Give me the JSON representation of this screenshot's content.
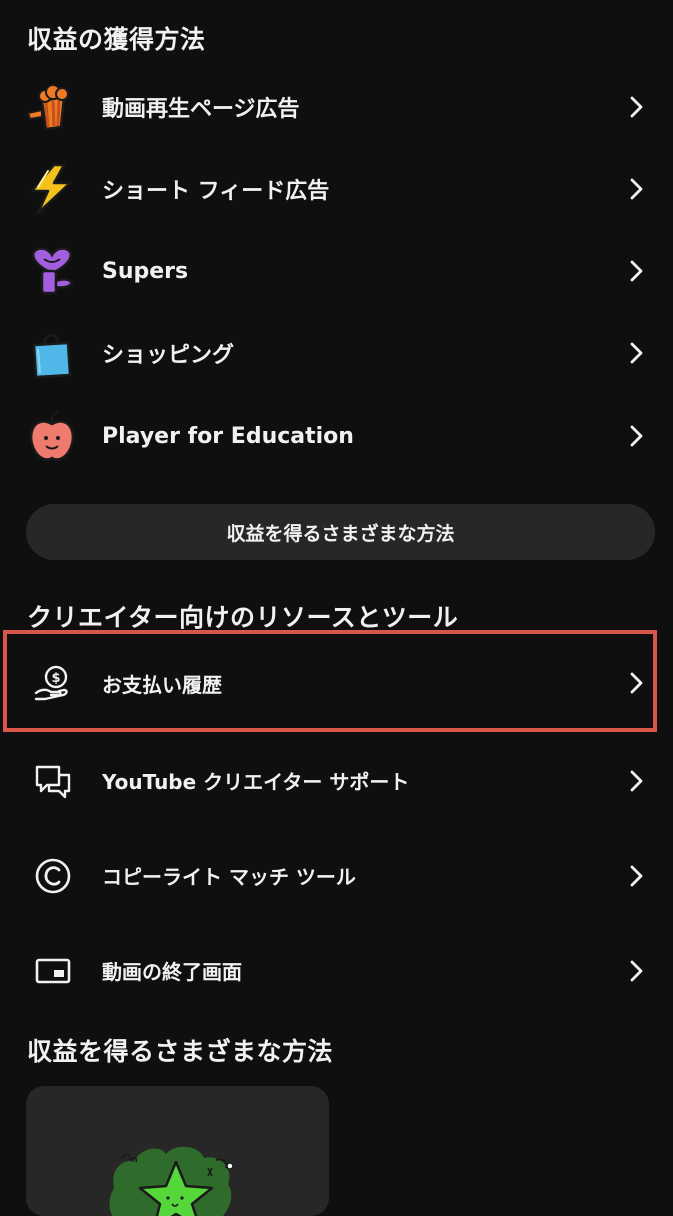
{
  "monetization": {
    "title": "収益の獲得方法",
    "items": [
      {
        "label": "動画再生ページ広告",
        "icon": "popcorn-icon"
      },
      {
        "label": "ショート フィード広告",
        "icon": "lightning-bolt-icon"
      },
      {
        "label": "Supers",
        "icon": "heart-sticker-icon"
      },
      {
        "label": "ショッピング",
        "icon": "shopping-bag-icon"
      },
      {
        "label": "Player for Education",
        "icon": "apple-icon"
      }
    ],
    "more_button": "収益を得るさまざまな方法"
  },
  "resources": {
    "title": "クリエイター向けのリソースとツール",
    "items": [
      {
        "label": "お支払い履歴",
        "icon": "payment-hand-icon"
      },
      {
        "label": "YouTube クリエイター サポート",
        "icon": "chat-bubbles-icon"
      },
      {
        "label": "コピーライト マッチ ツール",
        "icon": "copyright-icon"
      },
      {
        "label": "動画の終了画面",
        "icon": "end-screen-icon"
      }
    ]
  },
  "ways": {
    "title": "収益を得るさまざまな方法",
    "card_icon": "star-character-icon"
  },
  "colors": {
    "background": "#0f0f0f",
    "surface": "#272727",
    "text": "#f1f1f1",
    "highlight_border": "#d9564a"
  }
}
